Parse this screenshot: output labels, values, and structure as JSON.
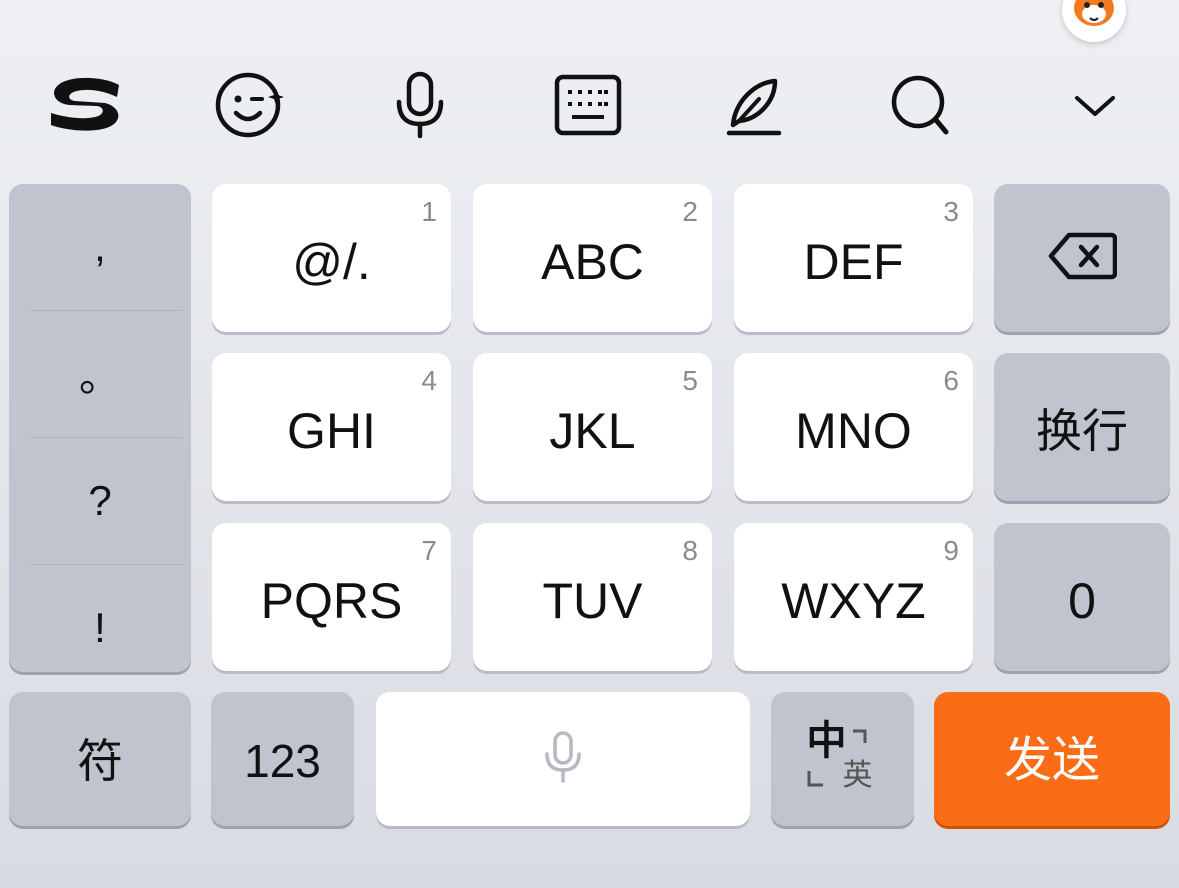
{
  "toolbar": {
    "icons": [
      "sogou-logo-icon",
      "emoji-wink-icon",
      "microphone-icon",
      "keyboard-icon",
      "handwriting-feather-icon",
      "search-icon",
      "chevron-down-icon"
    ]
  },
  "keys": {
    "row1": [
      {
        "label": "@/.",
        "num": "1"
      },
      {
        "label": "ABC",
        "num": "2"
      },
      {
        "label": "DEF",
        "num": "3"
      }
    ],
    "row2": [
      {
        "label": "GHI",
        "num": "4"
      },
      {
        "label": "JKL",
        "num": "5"
      },
      {
        "label": "MNO",
        "num": "6"
      }
    ],
    "row3": [
      {
        "label": "PQRS",
        "num": "7"
      },
      {
        "label": "TUV",
        "num": "8"
      },
      {
        "label": "WXYZ",
        "num": "9"
      }
    ],
    "enter_label": "换行",
    "zero_label": "0"
  },
  "punctuation": [
    ",",
    "。",
    "?",
    "!"
  ],
  "bottom": {
    "symbols_label": "符",
    "numbers_label": "123",
    "lang_primary": "中",
    "lang_secondary": "英",
    "send_label": "发送"
  },
  "colors": {
    "accent": "#fb6c16",
    "key_white": "#ffffff",
    "key_gray": "#c0c4cf"
  }
}
